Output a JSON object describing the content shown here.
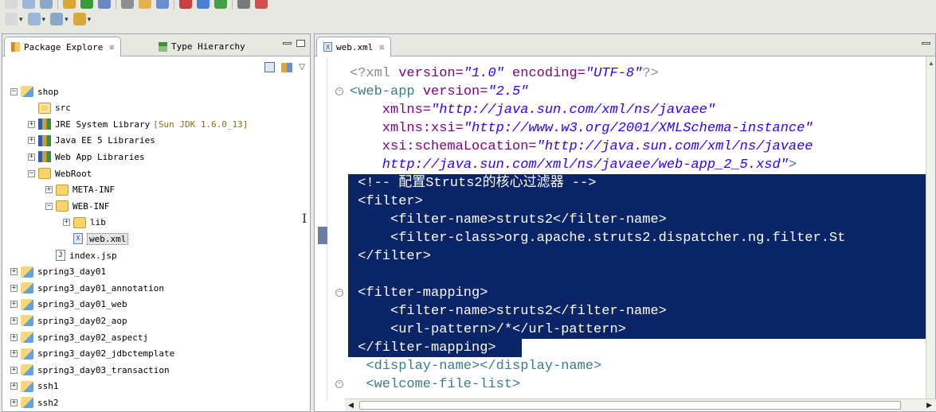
{
  "toolbar": {
    "row1_icons": [
      "new-icon",
      "save-icon",
      "print-icon",
      "debug-icon",
      "run-icon",
      "server-icon",
      "search-icon",
      "deploy-icon",
      "open-type-icon",
      "bug-icon",
      "globe-icon",
      "check-icon",
      "server-manage-icon",
      "plugin-icon"
    ],
    "row2_icons": [
      "next-annotation-icon",
      "prev-annotation-icon",
      "back-icon",
      "forward-icon"
    ]
  },
  "left_view": {
    "tabs": [
      {
        "label": "Package Explore",
        "close": "☒",
        "icon": "package-explorer-icon"
      },
      {
        "label": "Type Hierarchy",
        "icon": "type-hierarchy-icon"
      }
    ],
    "tree": [
      {
        "label": "shop",
        "level": 0,
        "toggle": "⊟",
        "icon": "project"
      },
      {
        "label": "src",
        "level": 1,
        "toggle": "",
        "icon": "pkgfolder"
      },
      {
        "label": "JRE System Library",
        "deco": "[Sun JDK 1.6.0_13]",
        "level": 1,
        "toggle": "⊞",
        "icon": "lib"
      },
      {
        "label": "Java EE 5 Libraries",
        "level": 1,
        "toggle": "⊞",
        "icon": "lib"
      },
      {
        "label": "Web App Libraries",
        "level": 1,
        "toggle": "⊞",
        "icon": "lib"
      },
      {
        "label": "WebRoot",
        "level": 1,
        "toggle": "⊟",
        "icon": "folder"
      },
      {
        "label": "META-INF",
        "level": 2,
        "toggle": "⊞",
        "icon": "folder"
      },
      {
        "label": "WEB-INF",
        "level": 2,
        "toggle": "⊟",
        "icon": "folder"
      },
      {
        "label": "lib",
        "level": 3,
        "toggle": "⊞",
        "icon": "folder"
      },
      {
        "label": "web.xml",
        "level": 3,
        "toggle": "",
        "icon": "xml",
        "selected": true
      },
      {
        "label": "index.jsp",
        "level": 2,
        "toggle": "",
        "icon": "jsp"
      },
      {
        "label": "spring3_day01",
        "level": 0,
        "toggle": "⊞",
        "icon": "project"
      },
      {
        "label": "spring3_day01_annotation",
        "level": 0,
        "toggle": "⊞",
        "icon": "project"
      },
      {
        "label": "spring3_day01_web",
        "level": 0,
        "toggle": "⊞",
        "icon": "project"
      },
      {
        "label": "spring3_day02_aop",
        "level": 0,
        "toggle": "⊞",
        "icon": "project"
      },
      {
        "label": "spring3_day02_aspectj",
        "level": 0,
        "toggle": "⊞",
        "icon": "project"
      },
      {
        "label": "spring3_day02_jdbctemplate",
        "level": 0,
        "toggle": "⊞",
        "icon": "project"
      },
      {
        "label": "spring3_day03_transaction",
        "level": 0,
        "toggle": "⊞",
        "icon": "project"
      },
      {
        "label": "ssh1",
        "level": 0,
        "toggle": "⊞",
        "icon": "project"
      },
      {
        "label": "ssh2",
        "level": 0,
        "toggle": "⊞",
        "icon": "project"
      }
    ]
  },
  "editor": {
    "tab": {
      "label": "web.xml",
      "close": "☒",
      "icon": "xml-file-icon"
    },
    "lines": [
      {
        "i": 0,
        "fold": "",
        "hl": false,
        "segs": [
          [
            "pi",
            "<?xml "
          ],
          [
            "an",
            "version="
          ],
          [
            "av",
            "\"1.0\""
          ],
          [
            "an",
            " encoding="
          ],
          [
            "av",
            "\"UTF-8\""
          ],
          [
            "pi",
            "?>"
          ]
        ]
      },
      {
        "i": 0,
        "fold": "⊖",
        "hl": false,
        "segs": [
          [
            "tg",
            "<web-app "
          ],
          [
            "an",
            "version="
          ],
          [
            "av",
            "\"2.5\""
          ]
        ]
      },
      {
        "i": 4,
        "fold": "",
        "hl": false,
        "segs": [
          [
            "an",
            "xmlns="
          ],
          [
            "av",
            "\"http://java.sun.com/xml/ns/javaee\""
          ]
        ]
      },
      {
        "i": 4,
        "fold": "",
        "hl": false,
        "segs": [
          [
            "an",
            "xmlns:xsi="
          ],
          [
            "av",
            "\"http://www.w3.org/2001/XMLSchema-instance\""
          ]
        ]
      },
      {
        "i": 4,
        "fold": "",
        "hl": false,
        "segs": [
          [
            "an",
            "xsi:schemaLocation="
          ],
          [
            "av",
            "\"http://java.sun.com/xml/ns/javaee"
          ]
        ]
      },
      {
        "i": 4,
        "fold": "",
        "hl": false,
        "segs": [
          [
            "av",
            "http://java.sun.com/xml/ns/javaee/web-app_2_5.xsd\""
          ],
          [
            "tg",
            ">"
          ]
        ]
      },
      {
        "i": 1,
        "fold": "",
        "hl": true,
        "segs": [
          [
            "w",
            "<!-- 配置Struts2的核心过滤器 -->"
          ]
        ]
      },
      {
        "i": 1,
        "fold": "",
        "hl": true,
        "segs": [
          [
            "w",
            "<filter>"
          ]
        ]
      },
      {
        "i": 5,
        "fold": "",
        "hl": true,
        "segs": [
          [
            "w",
            "<filter-name>struts2</filter-name>"
          ]
        ]
      },
      {
        "i": 5,
        "fold": "",
        "hl": true,
        "segs": [
          [
            "w",
            "<filter-class>org.apache.struts2.dispatcher.ng.filter.St"
          ]
        ]
      },
      {
        "i": 1,
        "fold": "",
        "hl": true,
        "segs": [
          [
            "w",
            "</filter>"
          ]
        ]
      },
      {
        "i": 1,
        "fold": "",
        "hl": true,
        "segs": [
          [
            "w",
            ""
          ]
        ]
      },
      {
        "i": 1,
        "fold": "⊖",
        "hl": true,
        "segs": [
          [
            "w",
            "<filter-mapping>"
          ]
        ]
      },
      {
        "i": 5,
        "fold": "",
        "hl": true,
        "segs": [
          [
            "w",
            "<filter-name>struts2</filter-name>"
          ]
        ]
      },
      {
        "i": 5,
        "fold": "",
        "hl": true,
        "segs": [
          [
            "w",
            "<url-pattern>/*</url-pattern>"
          ]
        ]
      },
      {
        "i": 1,
        "fold": "",
        "hl": true,
        "partial": true,
        "segs": [
          [
            "w",
            "</filter-mapping>"
          ]
        ]
      },
      {
        "i": 2,
        "fold": "",
        "hl": false,
        "segs": [
          [
            "tg",
            "<display-name></display-name>"
          ]
        ]
      },
      {
        "i": 2,
        "fold": "⊖",
        "hl": false,
        "segs": [
          [
            "tg",
            "<welcome-file-list>"
          ]
        ]
      }
    ]
  },
  "colors": {
    "selection": "#0a2468",
    "tag": "#3b7c8f",
    "attr_name": "#7f007f",
    "attr_value": "#2a00ff"
  }
}
